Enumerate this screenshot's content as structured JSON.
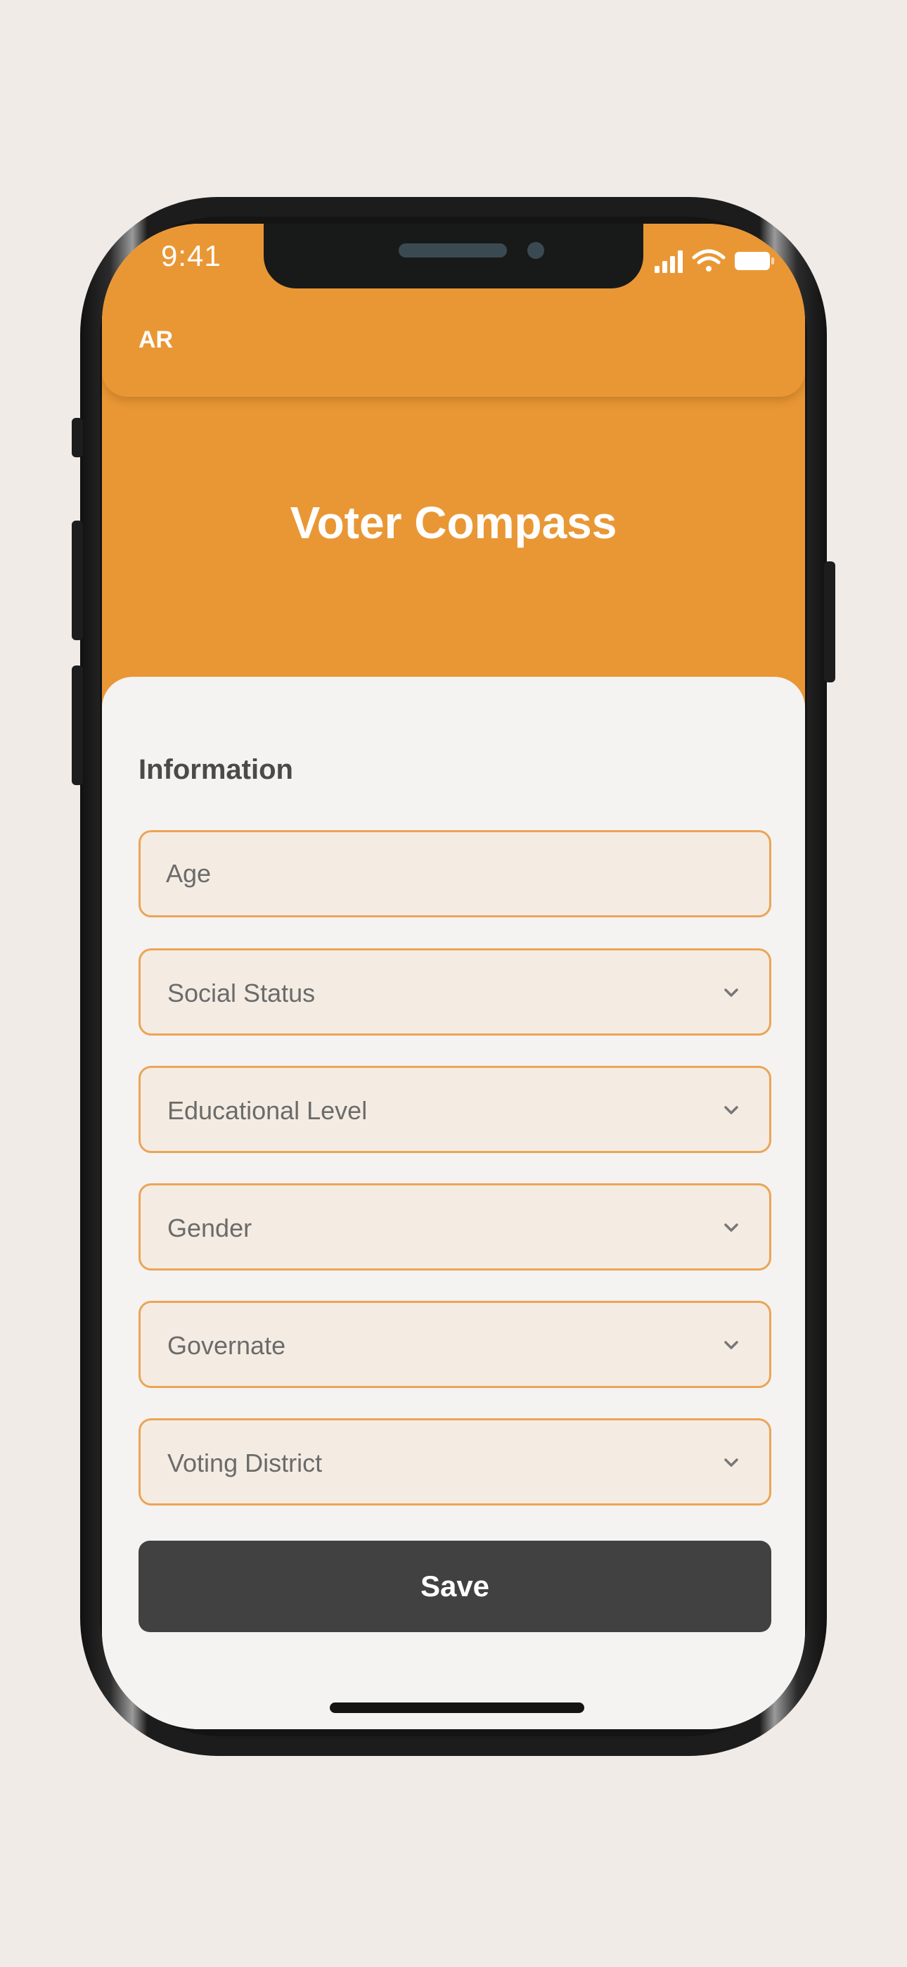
{
  "status_bar": {
    "time": "9:41",
    "signal_icon": "cellular-signal-icon",
    "wifi_icon": "wifi-icon",
    "battery_icon": "battery-icon"
  },
  "header": {
    "language_toggle": "AR",
    "title": "Voter Compass",
    "background_color": "#e99735"
  },
  "form": {
    "section_title": "Information",
    "fields": [
      {
        "label": "Age",
        "type": "text"
      },
      {
        "label": "Social Status",
        "type": "dropdown"
      },
      {
        "label": "Educational Level",
        "type": "dropdown"
      },
      {
        "label": "Gender",
        "type": "dropdown"
      },
      {
        "label": "Governate",
        "type": "dropdown"
      },
      {
        "label": "Voting District",
        "type": "dropdown"
      }
    ],
    "field_border_color": "#eca456",
    "field_fill_color": "#f4ece2",
    "save_label": "Save",
    "save_color": "#414141"
  }
}
